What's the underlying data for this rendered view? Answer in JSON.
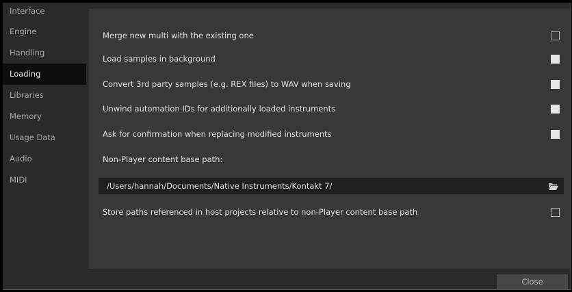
{
  "sidebar": {
    "items": [
      {
        "label": "Interface"
      },
      {
        "label": "Engine"
      },
      {
        "label": "Handling"
      },
      {
        "label": "Loading"
      },
      {
        "label": "Libraries"
      },
      {
        "label": "Memory"
      },
      {
        "label": "Usage Data"
      },
      {
        "label": "Audio"
      },
      {
        "label": "MIDI"
      }
    ],
    "active": "Loading"
  },
  "options": [
    {
      "label": "Merge new multi with the existing one",
      "checked": false
    },
    {
      "label": "Load samples in background",
      "checked": true
    },
    {
      "label": "Convert 3rd party samples (e.g. REX files) to WAV when saving",
      "checked": true
    },
    {
      "label": "Unwind automation IDs for additionally loaded instruments",
      "checked": true
    },
    {
      "label": "Ask for confirmation when replacing modified instruments",
      "checked": true
    }
  ],
  "content_path": {
    "label": "Non-Player content base path:",
    "value": "/Users/hannah/Documents/Native Instruments/Kontakt 7/",
    "browse_icon": "folder-icon"
  },
  "relative_paths": {
    "label": "Store paths referenced in host projects relative to non-Player content base path",
    "checked": false
  },
  "footer": {
    "close_label": "Close"
  },
  "colors": {
    "window_bg": "#2a2a2a",
    "panel_bg": "#383838",
    "active_nav_bg": "#0e0e0e",
    "field_bg": "#1f1f1f"
  }
}
